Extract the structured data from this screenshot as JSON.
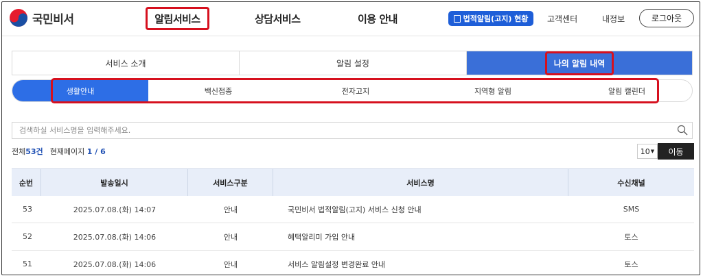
{
  "header": {
    "logo_text": "국민비서",
    "nav": [
      "알림서비스",
      "상담서비스",
      "이용 안내"
    ],
    "legal_button": "법적알림(고지) 현황",
    "links": [
      "고객센터",
      "내정보"
    ],
    "logout": "로그아웃"
  },
  "main_tabs": [
    "서비스 소개",
    "알림 설정",
    "나의 알림 내역"
  ],
  "sub_tabs": [
    "생활안내",
    "백신접종",
    "전자고지",
    "지역형 알림",
    "알림 캘린더"
  ],
  "search": {
    "placeholder": "검색하실 서비스명을 입력해주세요."
  },
  "info": {
    "total_label": "전체",
    "total_count": "53건",
    "page_label": "현재페이지",
    "page_value": "1 / 6"
  },
  "pager": {
    "page_size": "10",
    "move_label": "이동"
  },
  "table": {
    "headers": [
      "순번",
      "발송일시",
      "서비스구분",
      "서비스명",
      "수신채널"
    ],
    "rows": [
      [
        "53",
        "2025.07.08.(화) 14:07",
        "안내",
        "국민비서 법적알림(고지) 서비스 신청 안내",
        "SMS"
      ],
      [
        "52",
        "2025.07.08.(화) 14:06",
        "안내",
        "혜택알리미 가입 안내",
        "토스"
      ],
      [
        "51",
        "2025.07.08.(화) 14:06",
        "안내",
        "서비스 알림설정 변경완료 안내",
        "토스"
      ]
    ]
  },
  "colors": {
    "accent": "#2d6ee6",
    "highlight": "#d6101e",
    "legal_button": "#1e5ed8"
  }
}
